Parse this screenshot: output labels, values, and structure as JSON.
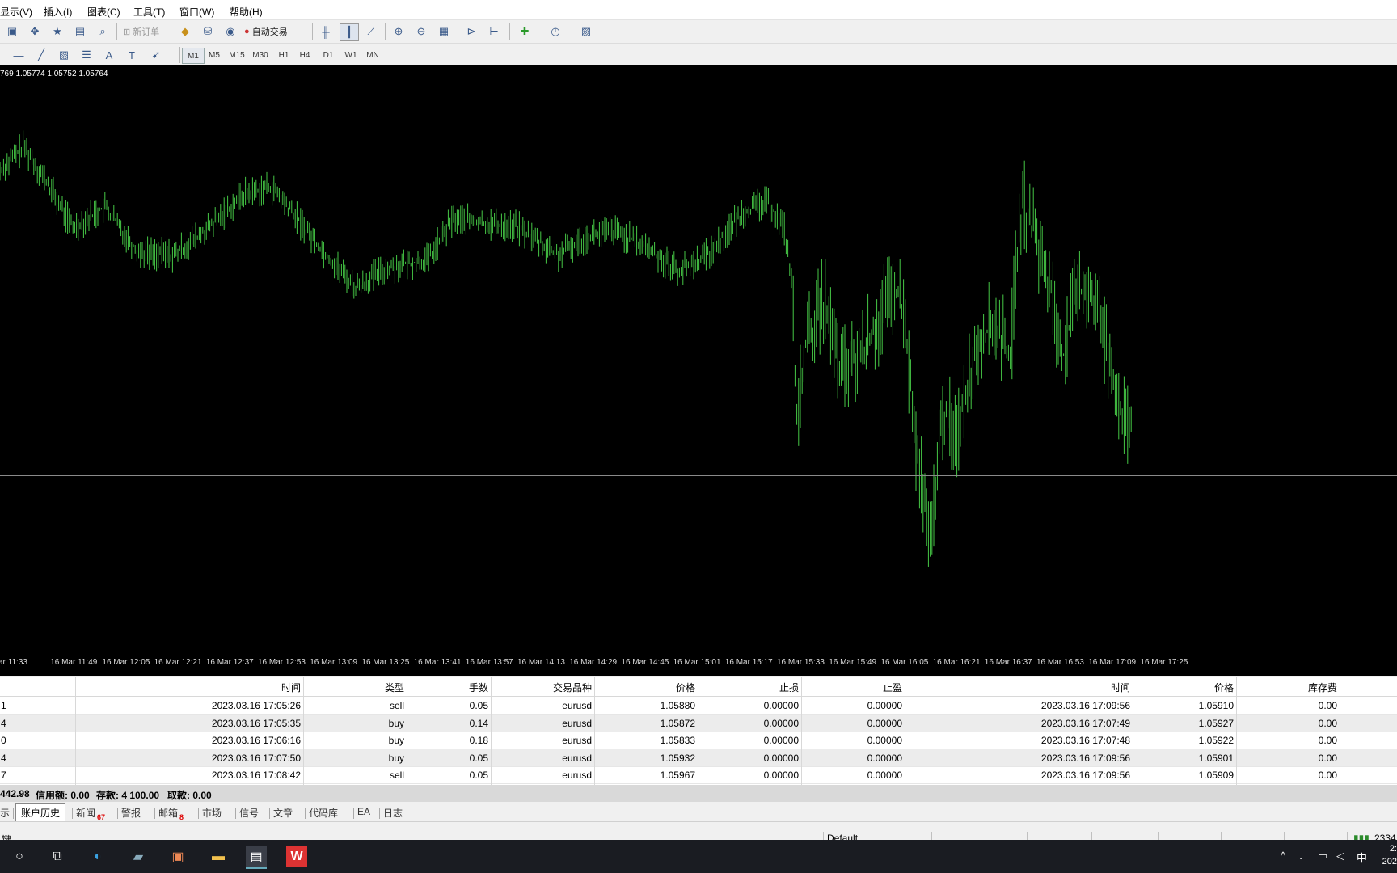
{
  "menu": [
    "显示(V)",
    "插入(I)",
    "图表(C)",
    "工具(T)",
    "窗口(W)",
    "帮助(H)"
  ],
  "toolbar": {
    "new_order": "新订单",
    "auto_trade": "自动交易",
    "timeframes": [
      "M1",
      "M5",
      "M15",
      "M30",
      "H1",
      "H4",
      "D1",
      "W1",
      "MN"
    ]
  },
  "chart": {
    "ohlc_label": "769 1.05774 1.05752 1.05764",
    "time_ticks": [
      "ar 11:33",
      "16 Mar 11:49",
      "16 Mar 12:05",
      "16 Mar 12:21",
      "16 Mar 12:37",
      "16 Mar 12:53",
      "16 Mar 13:09",
      "16 Mar 13:25",
      "16 Mar 13:41",
      "16 Mar 13:57",
      "16 Mar 14:13",
      "16 Mar 14:29",
      "16 Mar 14:45",
      "16 Mar 15:01",
      "16 Mar 15:17",
      "16 Mar 15:33",
      "16 Mar 15:49",
      "16 Mar 16:05",
      "16 Mar 16:21",
      "16 Mar 16:37",
      "16 Mar 16:53",
      "16 Mar 17:09",
      "16 Mar 17:25"
    ],
    "candle_color": "#46c846",
    "background": "#000000"
  },
  "table": {
    "headers": [
      "时间",
      "类型",
      "手数",
      "交易品种",
      "价格",
      "止损",
      "止盈",
      "时间",
      "价格",
      "库存费"
    ],
    "rows": [
      [
        "1",
        "2023.03.16 17:05:26",
        "sell",
        "0.05",
        "eurusd",
        "1.05880",
        "0.00000",
        "0.00000",
        "2023.03.16 17:09:56",
        "1.05910",
        "0.00"
      ],
      [
        "4",
        "2023.03.16 17:05:35",
        "buy",
        "0.14",
        "eurusd",
        "1.05872",
        "0.00000",
        "0.00000",
        "2023.03.16 17:07:49",
        "1.05927",
        "0.00"
      ],
      [
        "0",
        "2023.03.16 17:06:16",
        "buy",
        "0.18",
        "eurusd",
        "1.05833",
        "0.00000",
        "0.00000",
        "2023.03.16 17:07:48",
        "1.05922",
        "0.00"
      ],
      [
        "4",
        "2023.03.16 17:07:50",
        "buy",
        "0.05",
        "eurusd",
        "1.05932",
        "0.00000",
        "0.00000",
        "2023.03.16 17:09:56",
        "1.05901",
        "0.00"
      ],
      [
        "7",
        "2023.03.16 17:08:42",
        "sell",
        "0.05",
        "eurusd",
        "1.05967",
        "0.00000",
        "0.00000",
        "2023.03.16 17:09:56",
        "1.05909",
        "0.00"
      ]
    ]
  },
  "summary": {
    "balance": "442.98",
    "credit": "信用额: 0.00",
    "deposit": "存款: 4 100.00",
    "withdrawal": "取款: 0.00"
  },
  "tabs": [
    {
      "label": "示",
      "badge": ""
    },
    {
      "label": "账户历史",
      "badge": ""
    },
    {
      "label": "新闻",
      "badge": "67"
    },
    {
      "label": "警报",
      "badge": ""
    },
    {
      "label": "邮箱",
      "badge": "8"
    },
    {
      "label": "市场",
      "badge": ""
    },
    {
      "label": "信号",
      "badge": ""
    },
    {
      "label": "文章",
      "badge": ""
    },
    {
      "label": "代码库",
      "badge": ""
    },
    {
      "label": "EA",
      "badge": ""
    },
    {
      "label": "日志",
      "badge": ""
    }
  ],
  "status": {
    "left": "键",
    "profile": "Default",
    "right": "2334"
  },
  "taskbar": {
    "ime": "中",
    "clock_time": "2:",
    "clock_date": "202"
  }
}
